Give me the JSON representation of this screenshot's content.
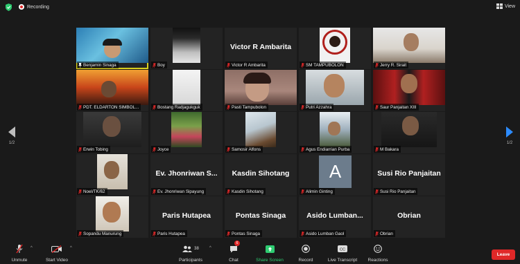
{
  "topbar": {
    "recording_label": "Recording",
    "view_label": "View"
  },
  "pagination": {
    "left_page": "1/2",
    "right_page": "1/2"
  },
  "participants": [
    {
      "id": "p01",
      "name": "Benjamin Sinaga"
    },
    {
      "id": "p02",
      "name": "Boy"
    },
    {
      "id": "p03",
      "name": "Victor R Ambarita",
      "display": "Victor R Ambarita"
    },
    {
      "id": "p04",
      "name": "SM TAMPUBOLON"
    },
    {
      "id": "p05",
      "name": "Jerry R. Sirait"
    },
    {
      "id": "p06",
      "name": "PDT. ELDARTON SIMBOL..."
    },
    {
      "id": "p07",
      "name": "Bostang Radjagukguk"
    },
    {
      "id": "p08",
      "name": "Pasti Tampubolon"
    },
    {
      "id": "p09",
      "name": "Putri Azzahra"
    },
    {
      "id": "p10",
      "name": "Saur Panjaitan XIII"
    },
    {
      "id": "p11",
      "name": "Erwin Tobing"
    },
    {
      "id": "p12",
      "name": "Joyce"
    },
    {
      "id": "p13",
      "name": "Samosir Alfons"
    },
    {
      "id": "p14",
      "name": "Agus Endiarrian Purba"
    },
    {
      "id": "p15",
      "name": "M Bakara"
    },
    {
      "id": "p16",
      "name": "Noel/TK/62"
    },
    {
      "id": "p17",
      "name": "Ev. Jhonriwan Sipayung",
      "display": "Ev. Jhonriwan S..."
    },
    {
      "id": "p18",
      "name": "Kasdin Sihotang",
      "display": "Kasdin Sihotang"
    },
    {
      "id": "p19",
      "name": "Alimin Ginting",
      "avatar_letter": "A"
    },
    {
      "id": "p20",
      "name": "Susi Rio Panjaitan",
      "display": "Susi Rio Panjaitan"
    },
    {
      "id": "p21",
      "name": "Sopandu Manurung"
    },
    {
      "id": "p22",
      "name": "Paris Hutapea",
      "display": "Paris Hutapea"
    },
    {
      "id": "p23",
      "name": "Pontas Sinaga",
      "display": "Pontas Sinaga"
    },
    {
      "id": "p24",
      "name": "Asido Lumban Gaol",
      "display": "Asido  Lumban..."
    },
    {
      "id": "p25",
      "name": "Obrian",
      "display": "Obrian"
    }
  ],
  "toolbar": {
    "unmute": "Unmute",
    "start_video": "Start Video",
    "participants": "Participants",
    "participants_count": "38",
    "chat": "Chat",
    "chat_badge": "6",
    "share_screen": "Share Screen",
    "record": "Record",
    "live_transcript": "Live Transcript",
    "reactions": "Reactions",
    "leave": "Leave"
  },
  "colors": {
    "share_green": "#2ecc71",
    "leave_red": "#e02828",
    "accent_blue": "#2d8cff",
    "active_speaker": "#d9d11f"
  }
}
